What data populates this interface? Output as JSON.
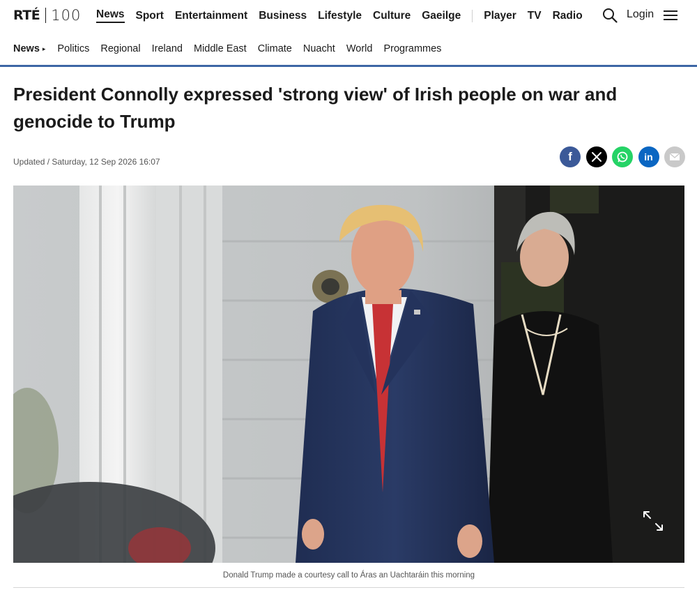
{
  "brand": {
    "logo_main": "RTÉ",
    "logo_anniversary": "100"
  },
  "main_nav": {
    "sections": [
      "News",
      "Sport",
      "Entertainment",
      "Business",
      "Lifestyle",
      "Culture",
      "Gaeilge"
    ],
    "media": [
      "Player",
      "TV",
      "Radio"
    ],
    "active": "News"
  },
  "header_actions": {
    "login_label": "Login",
    "search_icon": "search-icon",
    "menu_icon": "hamburger-menu-icon"
  },
  "sub_nav": {
    "title": "News",
    "items": [
      "Politics",
      "Regional",
      "Ireland",
      "Middle East",
      "Climate",
      "Nuacht",
      "World",
      "Programmes"
    ]
  },
  "article": {
    "headline": "President Connolly expressed 'strong view' of Irish people on war and genocide to Trump",
    "updated": "Updated / Saturday, 12 Sep 2026 16:07",
    "share_buttons": [
      {
        "name": "facebook",
        "glyph": "f",
        "color": "#3b5998"
      },
      {
        "name": "x",
        "glyph": "X",
        "color": "#000000"
      },
      {
        "name": "whatsapp",
        "glyph": "",
        "color": "#25d366"
      },
      {
        "name": "linkedin",
        "glyph": "in",
        "color": "#0a66c2"
      },
      {
        "name": "email",
        "glyph": "",
        "color": "#c9c9c9"
      }
    ],
    "image_caption": "Donald Trump made a courtesy call to Áras an Uachtaráin this morning",
    "expand_icon": "expand-icon"
  },
  "colors": {
    "accent_rule": "#3d66a5",
    "text": "#1b1b1b",
    "muted": "#555555"
  }
}
